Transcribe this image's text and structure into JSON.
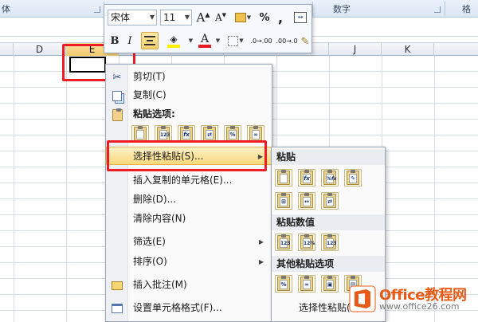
{
  "ribbon": {
    "left_fragment": "体",
    "right_fragment": "格",
    "number_group_label": "数字"
  },
  "columns": {
    "headers": [
      "D",
      "E",
      "F",
      "G",
      "H",
      "I",
      "J",
      "K"
    ],
    "selected": "E"
  },
  "mini_toolbar": {
    "font_name": "宋体",
    "font_size": "11",
    "grow_font": "A",
    "shrink_font": "A",
    "percent": "%",
    "comma": ",",
    "bold": "B",
    "italic": "I",
    "font_color_letter": "A",
    "increase_decimal": ".0→.00",
    "decrease_decimal": ".00→.0",
    "font_color": "#e31b23",
    "fill_color": "#ffef00"
  },
  "context_menu": {
    "cut": "剪切(T)",
    "copy": "复制(C)",
    "paste_options_header": "粘贴选项:",
    "paste_special": "选择性粘贴(S)...",
    "insert_copied": "插入复制的单元格(E)...",
    "delete": "删除(D)...",
    "clear": "清除内容(N)",
    "filter": "筛选(E)",
    "sort": "排序(O)",
    "insert_comment": "插入批注(M)",
    "format_cells": "设置单元格格式(F)...",
    "paste_option_icons": [
      "paste-icon",
      "paste-values-icon",
      "paste-formulas-icon",
      "transpose-icon",
      "paste-formatting-icon",
      "paste-link-icon"
    ]
  },
  "submenu": {
    "paste_header": "粘贴",
    "values_header": "粘贴数值",
    "other_header": "其他粘贴选项",
    "paste_special_item": "选择性粘贴(S)..."
  },
  "watermark": {
    "title": "Office教程网",
    "url": "www.office26.com"
  },
  "colors": {
    "highlight_red": "#ee1c24",
    "hover_gold": "#f8d97b",
    "watermark_orange": "#e85a16"
  }
}
